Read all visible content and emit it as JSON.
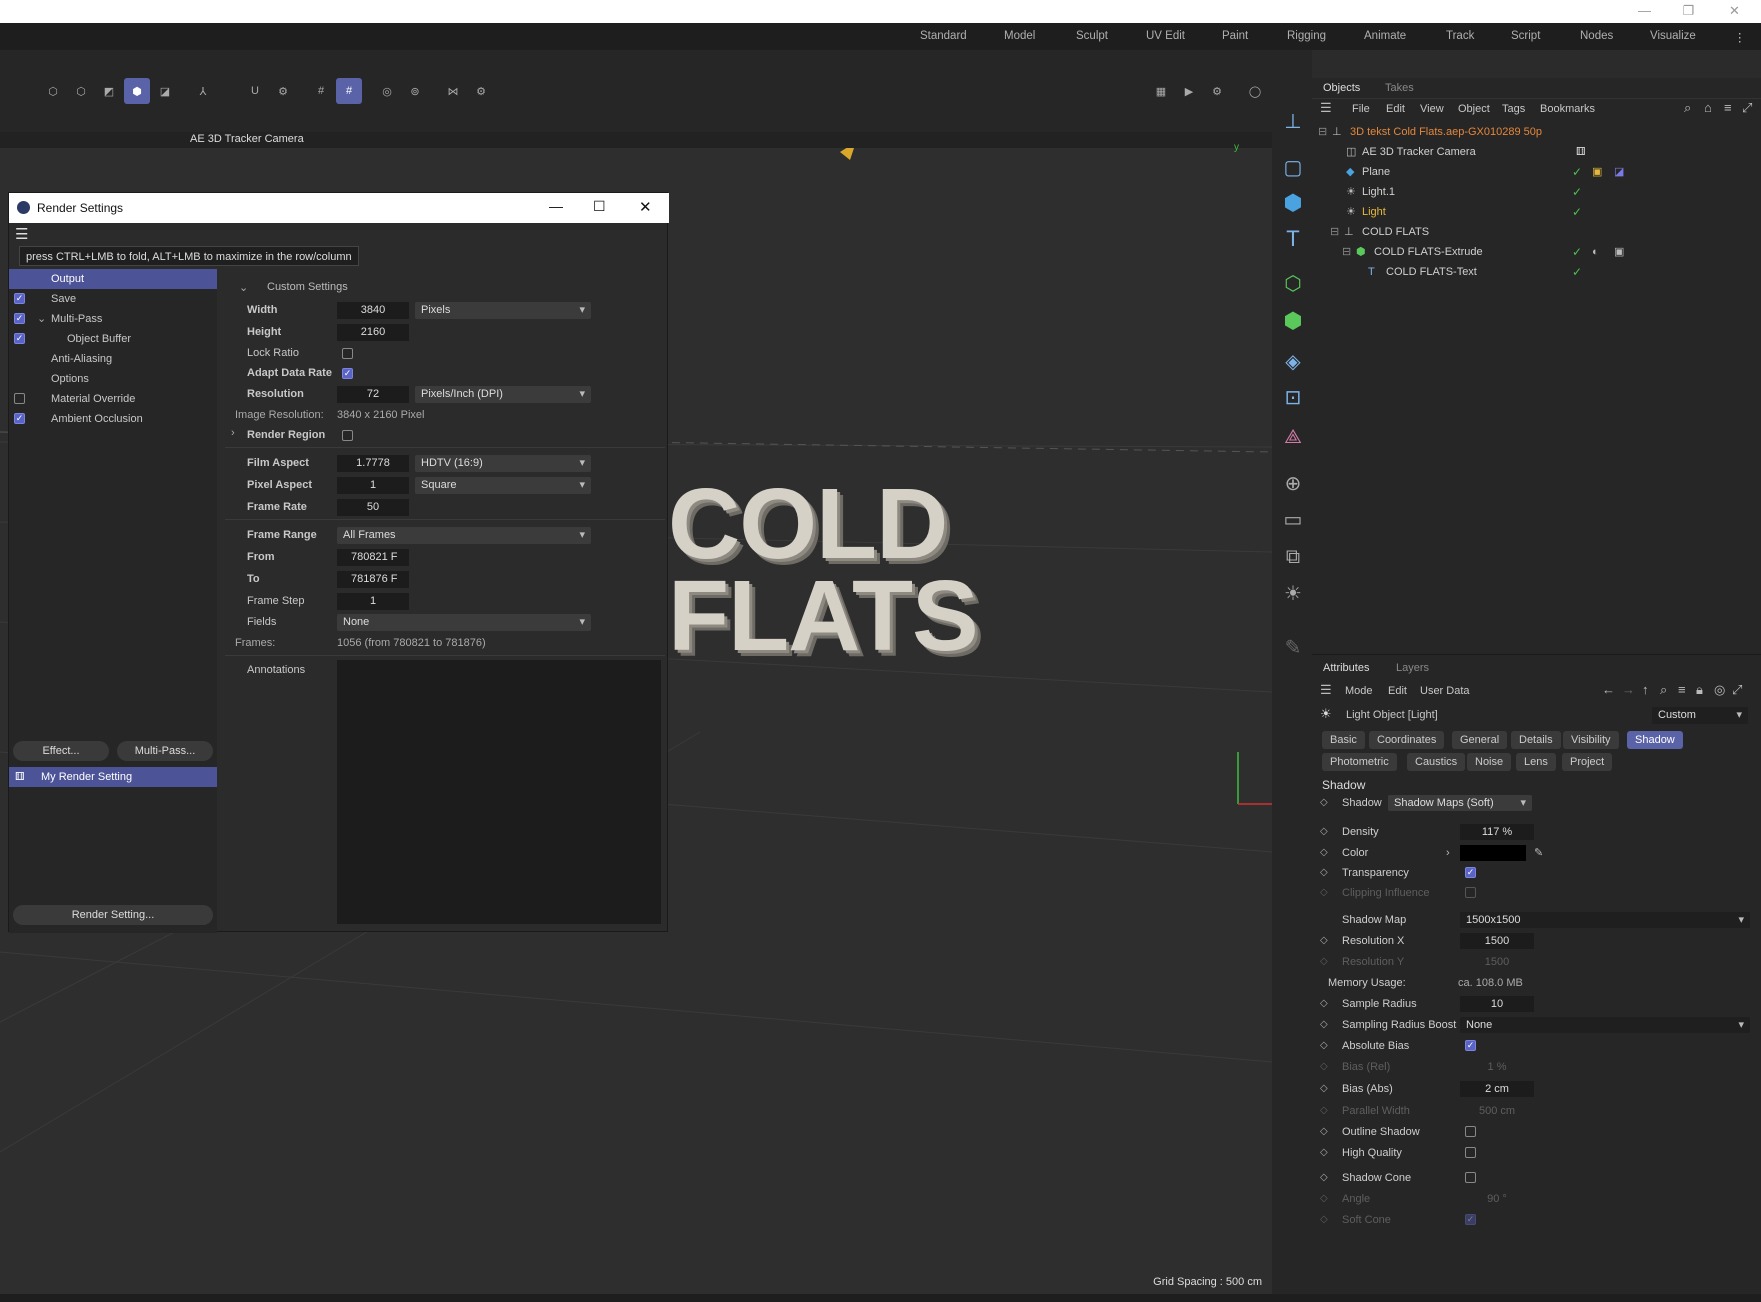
{
  "window": {
    "min": "—",
    "max": "❐",
    "close": "✕"
  },
  "layouts": [
    "Standard",
    "Model",
    "Sculpt",
    "UV Edit",
    "Paint",
    "Rigging",
    "Animate",
    "Track",
    "Script",
    "Nodes",
    "Visualize"
  ],
  "viewport": {
    "camera": "AE 3D Tracker Camera",
    "grid": "Grid Spacing : 500 cm",
    "text_line1": "COLD",
    "text_line2": "FLATS"
  },
  "render_dialog": {
    "title": "Render Settings",
    "tooltip": "press CTRL+LMB to fold, ALT+LMB to maximize in the row/column",
    "left_items": [
      {
        "label": "Output",
        "checked": null,
        "selected": true
      },
      {
        "label": "Save",
        "checked": true
      },
      {
        "label": "Multi-Pass",
        "checked": true
      },
      {
        "label": "Object Buffer",
        "checked": true
      },
      {
        "label": "Anti-Aliasing",
        "checked": null
      },
      {
        "label": "Options",
        "checked": null
      },
      {
        "label": "Material Override",
        "checked": false
      },
      {
        "label": "Ambient Occlusion",
        "checked": true
      }
    ],
    "effect_btn": "Effect...",
    "multipass_btn": "Multi-Pass...",
    "setting_name": "My Render Setting",
    "render_setting_btn": "Render Setting...",
    "custom_settings": "Custom Settings",
    "width_label": "Width",
    "width": "3840",
    "width_unit": "Pixels",
    "height_label": "Height",
    "height": "2160",
    "lock_ratio": "Lock Ratio",
    "adapt_label": "Adapt Data Rate",
    "res_label": "Resolution",
    "res": "72",
    "res_unit": "Pixels/Inch (DPI)",
    "img_res_label": "Image Resolution:",
    "img_res": "3840 x 2160 Pixel",
    "region_label": "Render Region",
    "film_label": "Film Aspect",
    "film": "1.7778",
    "film_preset": "HDTV (16:9)",
    "pixel_label": "Pixel Aspect",
    "pixel": "1",
    "pixel_preset": "Square",
    "fr_label": "Frame Rate",
    "fr": "50",
    "range_label": "Frame Range",
    "range": "All Frames",
    "from_label": "From",
    "from": "780821 F",
    "to_label": "To",
    "to": "781876 F",
    "step_label": "Frame Step",
    "step": "1",
    "fields_label": "Fields",
    "fields": "None",
    "frames_label": "Frames:",
    "frames": "1056 (from 780821 to 781876)",
    "annotations": "Annotations"
  },
  "objects": {
    "tabs": [
      "Objects",
      "Takes"
    ],
    "menu": [
      "File",
      "Edit",
      "View",
      "Object",
      "Tags",
      "Bookmarks"
    ],
    "items": [
      {
        "name": "3D tekst Cold Flats.aep-GX010289 50p",
        "color": "#e3873c"
      },
      {
        "name": "AE 3D Tracker Camera",
        "color": "#d0d0d0"
      },
      {
        "name": "Plane",
        "color": "#d0d0d0"
      },
      {
        "name": "Light.1",
        "color": "#d0d0d0"
      },
      {
        "name": "Light",
        "color": "#e6b83c"
      },
      {
        "name": "COLD FLATS",
        "color": "#d0d0d0"
      },
      {
        "name": "COLD FLATS-Extrude",
        "color": "#d0d0d0"
      },
      {
        "name": "COLD FLATS-Text",
        "color": "#d0d0d0"
      }
    ]
  },
  "attributes": {
    "tabs": [
      "Attributes",
      "Layers"
    ],
    "menu": [
      "Mode",
      "Edit",
      "User Data"
    ],
    "object": "Light Object [Light]",
    "preset": "Custom",
    "tabs_row1": [
      "Basic",
      "Coordinates",
      "General",
      "Details",
      "Visibility",
      "Shadow"
    ],
    "tabs_row2": [
      "Photometric",
      "Caustics",
      "Noise",
      "Lens",
      "Project"
    ],
    "section": "Shadow",
    "shadow_label": "Shadow",
    "shadow_value": "Shadow Maps (Soft)",
    "density": {
      "label": "Density",
      "value": "117 %"
    },
    "color": {
      "label": "Color"
    },
    "transparency": "Transparency",
    "clipping": "Clipping Influence",
    "shadow_map": {
      "label": "Shadow Map",
      "value": "1500x1500"
    },
    "res_x": {
      "label": "Resolution X",
      "value": "1500"
    },
    "res_y": {
      "label": "Resolution Y",
      "value": "1500"
    },
    "memory": {
      "label": "Memory Usage:",
      "value": "ca. 108.0 MB"
    },
    "sample_radius": {
      "label": "Sample Radius",
      "value": "10"
    },
    "boost": {
      "label": "Sampling Radius Boost",
      "value": "None"
    },
    "abs_bias": "Absolute Bias",
    "bias_rel": {
      "label": "Bias (Rel)",
      "value": "1 %"
    },
    "bias_abs": {
      "label": "Bias (Abs)",
      "value": "2 cm"
    },
    "parallel": {
      "label": "Parallel Width",
      "value": "500 cm"
    },
    "outline": "Outline Shadow",
    "hq": "High Quality",
    "cone": "Shadow Cone",
    "angle": {
      "label": "Angle",
      "value": "90 °"
    },
    "soft_cone": "Soft Cone"
  }
}
